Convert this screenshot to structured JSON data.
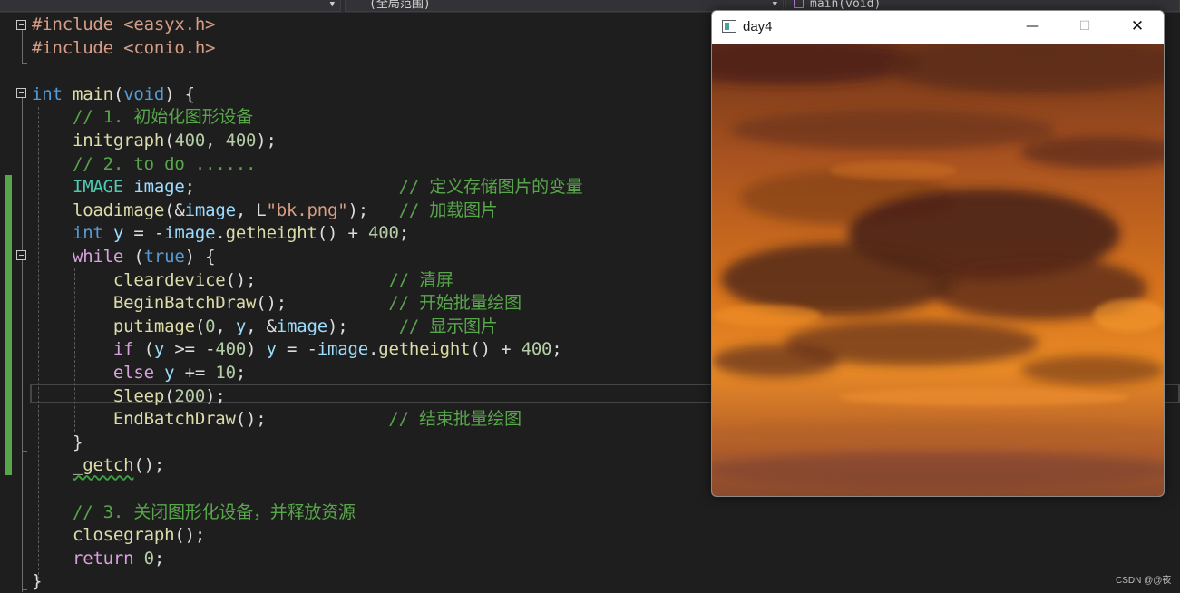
{
  "navbar": {
    "scope_dropdown": "(全局范围)",
    "member_dropdown": "main(void)"
  },
  "code_lines": [
    [
      {
        "c": "inc",
        "t": "#include <easyx.h>"
      }
    ],
    [
      {
        "c": "inc",
        "t": "#include <conio.h>"
      }
    ],
    [],
    [
      {
        "c": "k",
        "t": "int"
      },
      {
        "c": "",
        "t": " "
      },
      {
        "c": "f",
        "t": "main"
      },
      {
        "c": "",
        "t": "("
      },
      {
        "c": "k",
        "t": "void"
      },
      {
        "c": "",
        "t": ") {"
      }
    ],
    [
      {
        "c": "",
        "t": "    "
      },
      {
        "c": "c",
        "t": "// 1. 初始化图形设备"
      }
    ],
    [
      {
        "c": "",
        "t": "    "
      },
      {
        "c": "f",
        "t": "initgraph"
      },
      {
        "c": "",
        "t": "("
      },
      {
        "c": "n",
        "t": "400"
      },
      {
        "c": "",
        "t": ", "
      },
      {
        "c": "n",
        "t": "400"
      },
      {
        "c": "",
        "t": ");"
      }
    ],
    [
      {
        "c": "",
        "t": "    "
      },
      {
        "c": "c",
        "t": "// 2. to do ......"
      }
    ],
    [
      {
        "c": "",
        "t": "    "
      },
      {
        "c": "t",
        "t": "IMAGE"
      },
      {
        "c": "",
        "t": " "
      },
      {
        "c": "v",
        "t": "image"
      },
      {
        "c": "",
        "t": ";                    "
      },
      {
        "c": "c",
        "t": "// 定义存储图片的变量"
      }
    ],
    [
      {
        "c": "",
        "t": "    "
      },
      {
        "c": "f",
        "t": "loadimage"
      },
      {
        "c": "",
        "t": "(&"
      },
      {
        "c": "v",
        "t": "image"
      },
      {
        "c": "",
        "t": ", L"
      },
      {
        "c": "s",
        "t": "\"bk.png\""
      },
      {
        "c": "",
        "t": ");   "
      },
      {
        "c": "c",
        "t": "// 加载图片"
      }
    ],
    [
      {
        "c": "",
        "t": "    "
      },
      {
        "c": "k",
        "t": "int"
      },
      {
        "c": "",
        "t": " "
      },
      {
        "c": "v",
        "t": "y"
      },
      {
        "c": "",
        "t": " = -"
      },
      {
        "c": "v",
        "t": "image"
      },
      {
        "c": "",
        "t": "."
      },
      {
        "c": "f",
        "t": "getheight"
      },
      {
        "c": "",
        "t": "() + "
      },
      {
        "c": "n",
        "t": "400"
      },
      {
        "c": "",
        "t": ";"
      }
    ],
    [
      {
        "c": "",
        "t": "    "
      },
      {
        "c": "kc",
        "t": "while"
      },
      {
        "c": "",
        "t": " ("
      },
      {
        "c": "k",
        "t": "true"
      },
      {
        "c": "",
        "t": ") {"
      }
    ],
    [
      {
        "c": "",
        "t": "        "
      },
      {
        "c": "f",
        "t": "cleardevice"
      },
      {
        "c": "",
        "t": "();             "
      },
      {
        "c": "c",
        "t": "// 清屏"
      }
    ],
    [
      {
        "c": "",
        "t": "        "
      },
      {
        "c": "f",
        "t": "BeginBatchDraw"
      },
      {
        "c": "",
        "t": "();          "
      },
      {
        "c": "c",
        "t": "// 开始批量绘图"
      }
    ],
    [
      {
        "c": "",
        "t": "        "
      },
      {
        "c": "f",
        "t": "putimage"
      },
      {
        "c": "",
        "t": "("
      },
      {
        "c": "n",
        "t": "0"
      },
      {
        "c": "",
        "t": ", "
      },
      {
        "c": "v",
        "t": "y"
      },
      {
        "c": "",
        "t": ", &"
      },
      {
        "c": "v",
        "t": "image"
      },
      {
        "c": "",
        "t": ");     "
      },
      {
        "c": "c",
        "t": "// 显示图片"
      }
    ],
    [
      {
        "c": "",
        "t": "        "
      },
      {
        "c": "kc",
        "t": "if"
      },
      {
        "c": "",
        "t": " ("
      },
      {
        "c": "v",
        "t": "y"
      },
      {
        "c": "",
        "t": " >= -"
      },
      {
        "c": "n",
        "t": "400"
      },
      {
        "c": "",
        "t": ") "
      },
      {
        "c": "v",
        "t": "y"
      },
      {
        "c": "",
        "t": " = -"
      },
      {
        "c": "v",
        "t": "image"
      },
      {
        "c": "",
        "t": "."
      },
      {
        "c": "f",
        "t": "getheight"
      },
      {
        "c": "",
        "t": "() + "
      },
      {
        "c": "n",
        "t": "400"
      },
      {
        "c": "",
        "t": ";"
      }
    ],
    [
      {
        "c": "",
        "t": "        "
      },
      {
        "c": "kc",
        "t": "else"
      },
      {
        "c": "",
        "t": " "
      },
      {
        "c": "v",
        "t": "y"
      },
      {
        "c": "",
        "t": " += "
      },
      {
        "c": "n",
        "t": "10"
      },
      {
        "c": "",
        "t": ";"
      }
    ],
    [
      {
        "c": "",
        "t": "        "
      },
      {
        "c": "f",
        "t": "Sleep"
      },
      {
        "c": "",
        "t": "("
      },
      {
        "c": "n",
        "t": "200"
      },
      {
        "c": "",
        "t": ");"
      }
    ],
    [
      {
        "c": "",
        "t": "        "
      },
      {
        "c": "f",
        "t": "EndBatchDraw"
      },
      {
        "c": "",
        "t": "();            "
      },
      {
        "c": "c",
        "t": "// 结束批量绘图"
      }
    ],
    [
      {
        "c": "",
        "t": "    }"
      }
    ],
    [
      {
        "c": "",
        "t": "    "
      },
      {
        "c": "f sq",
        "t": "_getch"
      },
      {
        "c": "",
        "t": "();"
      }
    ],
    [],
    [
      {
        "c": "",
        "t": "    "
      },
      {
        "c": "c",
        "t": "// 3. 关闭图形化设备，并释放资源"
      }
    ],
    [
      {
        "c": "",
        "t": "    "
      },
      {
        "c": "f",
        "t": "closegraph"
      },
      {
        "c": "",
        "t": "();"
      }
    ],
    [
      {
        "c": "",
        "t": "    "
      },
      {
        "c": "kc",
        "t": "return"
      },
      {
        "c": "",
        "t": " "
      },
      {
        "c": "n",
        "t": "0"
      },
      {
        "c": "",
        "t": ";"
      }
    ],
    [
      {
        "c": "",
        "t": "}"
      }
    ]
  ],
  "window": {
    "title": "day4",
    "minimize_glyph": "—",
    "maximize_glyph": "☐",
    "close_glyph": "✕",
    "image_description_colors": [
      "#c4641a",
      "#5c2c1a",
      "#f08a22"
    ]
  },
  "watermark": "CSDN @@夜"
}
